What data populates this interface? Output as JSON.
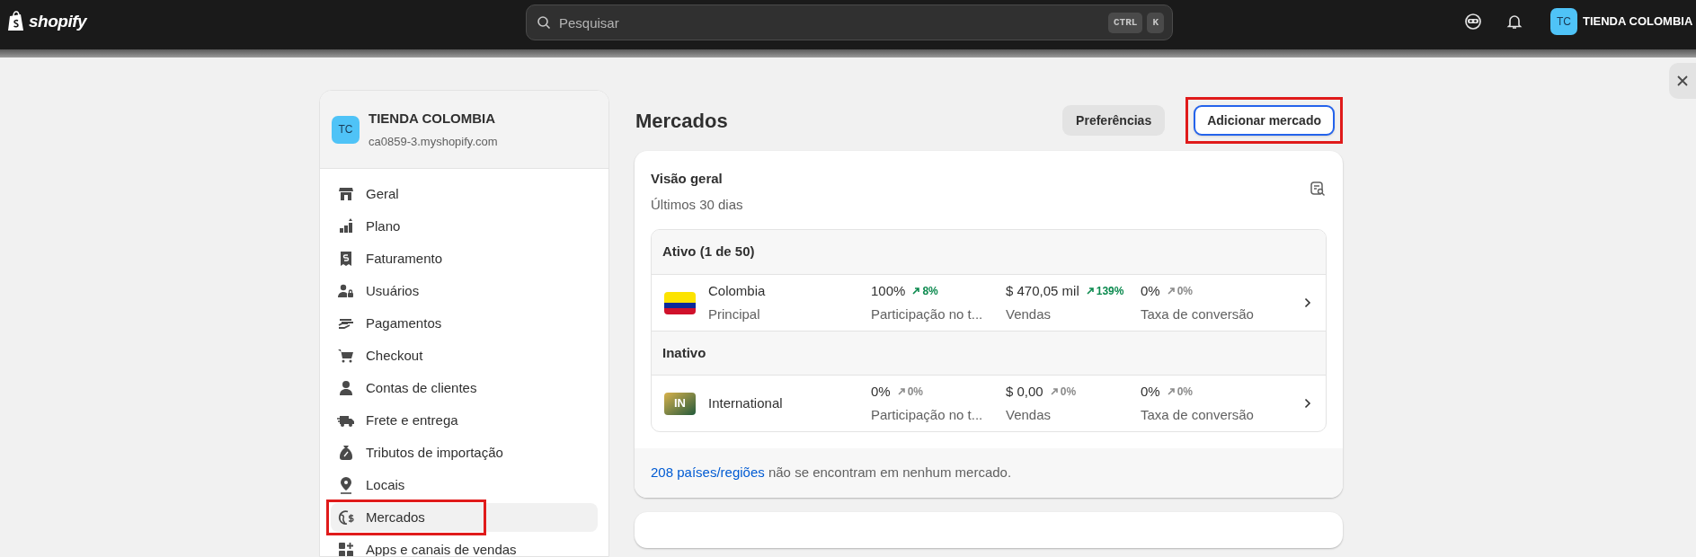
{
  "topbar": {
    "logo": "shopify",
    "search": {
      "placeholder": "Pesquisar",
      "keys": [
        "CTRL",
        "K"
      ]
    },
    "store": {
      "initials": "TC",
      "name": "TIENDA COLOMBIA"
    }
  },
  "sidebar": {
    "store": {
      "initials": "TC",
      "name": "TIENDA COLOMBIA",
      "domain": "ca0859-3.myshopify.com"
    },
    "items": [
      {
        "kind": "store",
        "label": "Geral",
        "selected": false,
        "highlighted": false
      },
      {
        "kind": "plan",
        "label": "Plano",
        "selected": false,
        "highlighted": false
      },
      {
        "kind": "billing",
        "label": "Faturamento",
        "selected": false,
        "highlighted": false
      },
      {
        "kind": "users",
        "label": "Usuários",
        "selected": false,
        "highlighted": false
      },
      {
        "kind": "payments",
        "label": "Pagamentos",
        "selected": false,
        "highlighted": false
      },
      {
        "kind": "cart",
        "label": "Checkout",
        "selected": false,
        "highlighted": false
      },
      {
        "kind": "person",
        "label": "Contas de clientes",
        "selected": false,
        "highlighted": false
      },
      {
        "kind": "truck",
        "label": "Frete e entrega",
        "selected": false,
        "highlighted": false
      },
      {
        "kind": "bag",
        "label": "Tributos de importação",
        "selected": false,
        "highlighted": false
      },
      {
        "kind": "pin",
        "label": "Locais",
        "selected": false,
        "highlighted": false
      },
      {
        "kind": "globe",
        "label": "Mercados",
        "selected": true,
        "highlighted": true
      },
      {
        "kind": "apps",
        "label": "Apps e canais de vendas",
        "selected": false,
        "highlighted": false
      }
    ]
  },
  "main": {
    "title": "Mercados",
    "buttons": [
      {
        "label": "Preferências",
        "kind": "secondary",
        "highlighted": false
      },
      {
        "label": "Adicionar mercado",
        "kind": "primary",
        "highlighted": true
      }
    ],
    "overview": {
      "title": "Visão geral",
      "subtitle": "Últimos 30 dias",
      "groups": [
        {
          "title": "Ativo (1 de 50)",
          "markets": [
            {
              "kind": "flag",
              "name": "Colombia",
              "subtitle": "Principal",
              "metrics": [
                {
                  "value": "100%",
                  "change": "8%",
                  "kind": "up",
                  "label": "Participação no t..."
                },
                {
                  "value": "$ 470,05 mil",
                  "change": "139%",
                  "kind": "up",
                  "label": "Vendas"
                },
                {
                  "value": "0%",
                  "change": "0%",
                  "kind": "flat",
                  "label": "Taxa de conversão"
                }
              ]
            }
          ]
        },
        {
          "title": "Inativo",
          "markets": [
            {
              "kind": "initials",
              "initials": "IN",
              "name": "International",
              "metrics": [
                {
                  "value": "0%",
                  "change": "0%",
                  "kind": "flat",
                  "label": "Participação no t..."
                },
                {
                  "value": "$ 0,00",
                  "change": "0%",
                  "kind": "flat",
                  "label": "Vendas"
                },
                {
                  "value": "0%",
                  "change": "0%",
                  "kind": "flat",
                  "label": "Taxa de conversão"
                }
              ]
            }
          ]
        }
      ],
      "footer": {
        "link": "208 países/regiões",
        "text": "não se encontram em nenhum mercado."
      }
    }
  }
}
